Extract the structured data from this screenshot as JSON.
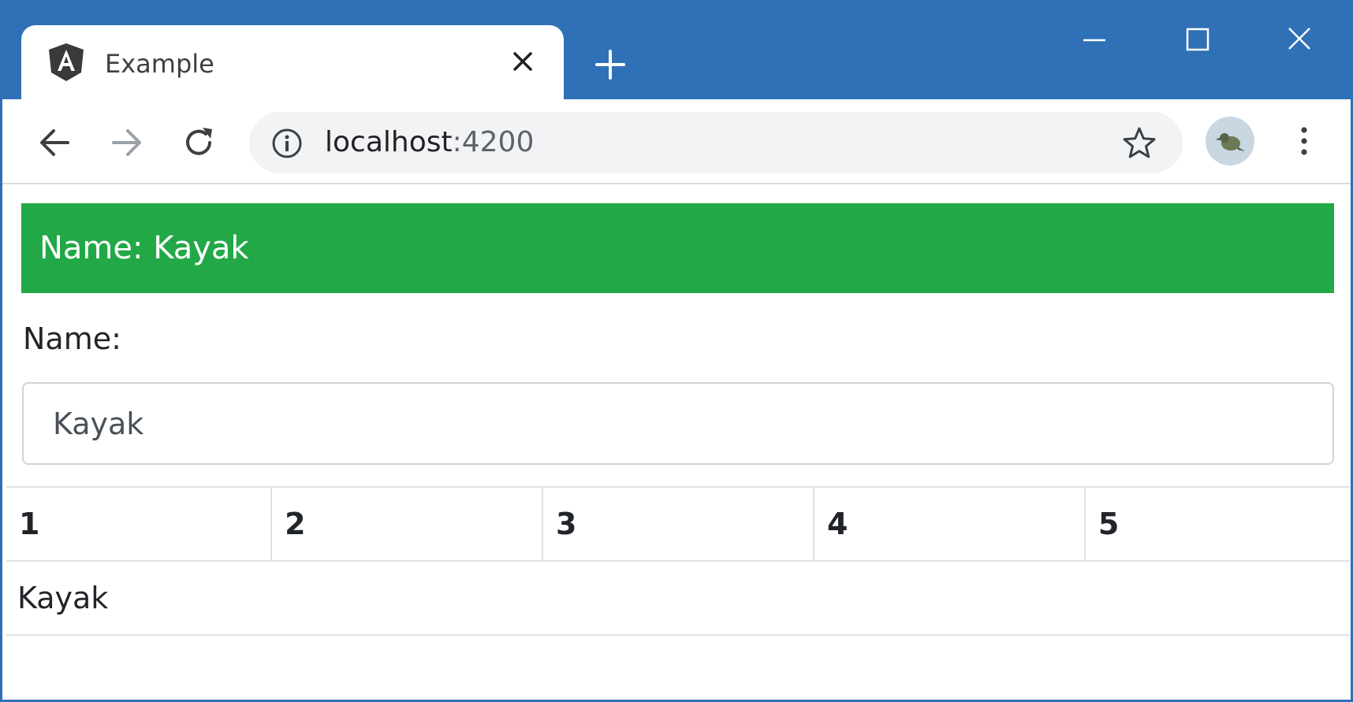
{
  "browser": {
    "tab": {
      "title": "Example",
      "icon": "angular-icon"
    },
    "address": {
      "host": "localhost",
      "port": ":4200"
    },
    "colors": {
      "frame": "#2f70b6",
      "omnibox": "#f1f3f4"
    }
  },
  "page": {
    "banner": {
      "text": "Name: Kayak",
      "color": "#22a846"
    },
    "name_label": "Name:",
    "name_input_value": "Kayak",
    "table": {
      "headers": [
        "1",
        "2",
        "3",
        "4",
        "5"
      ],
      "rows": [
        [
          "Kayak"
        ]
      ]
    }
  }
}
